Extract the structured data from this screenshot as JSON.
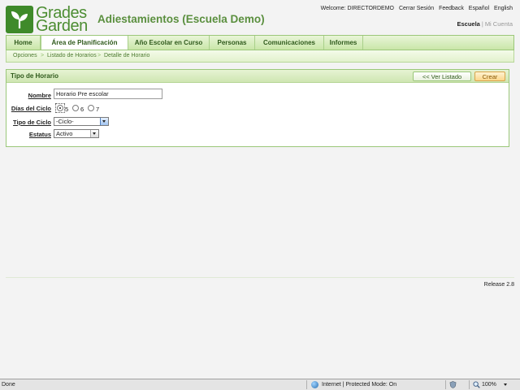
{
  "header": {
    "logo_line1": "Grades",
    "logo_line2": "Garden",
    "school_title": "Adiestamientos (Escuela Demo)",
    "welcome": "Welcome: DIRECTORDEMO",
    "logout": "Cerrar Sesión",
    "feedback": "Feedback",
    "lang_es": "Español",
    "lang_en": "English",
    "subnav_active": "Escuela",
    "subnav_sep": "|",
    "subnav_other": "Mi Cuenta"
  },
  "nav": {
    "tabs": [
      "Home",
      "Área de Planificación",
      "Año Escolar en Curso",
      "Personas",
      "Comunicaciones",
      "Informes"
    ],
    "active_index": 1
  },
  "breadcrumb": {
    "items": [
      "Opciones",
      "Listado de Horarios",
      "Detalle de Horario"
    ],
    "separator": ">"
  },
  "panel": {
    "title": "Tipo de Horario",
    "btn_list": "<< Ver Listado",
    "btn_create": "Crear"
  },
  "form": {
    "name_label": "Nombre",
    "name_value": "Horario Pre escolar",
    "days_label": "Días del Ciclo",
    "days_options": [
      "5",
      "6",
      "7"
    ],
    "days_selected": "5",
    "cycle_type_label": "Tipo de Ciclo",
    "cycle_type_value": "-Ciclo-",
    "status_label": "Estatus",
    "status_value": "Activo"
  },
  "footer": {
    "release": "Release 2.8"
  },
  "statusbar": {
    "done": "Done",
    "zone": "Internet | Protected Mode: On",
    "zoom": "100%"
  },
  "colors": {
    "brand_green": "#4c8d32",
    "nav_text": "#2f5a1c",
    "create_button": "#fbd58a"
  }
}
